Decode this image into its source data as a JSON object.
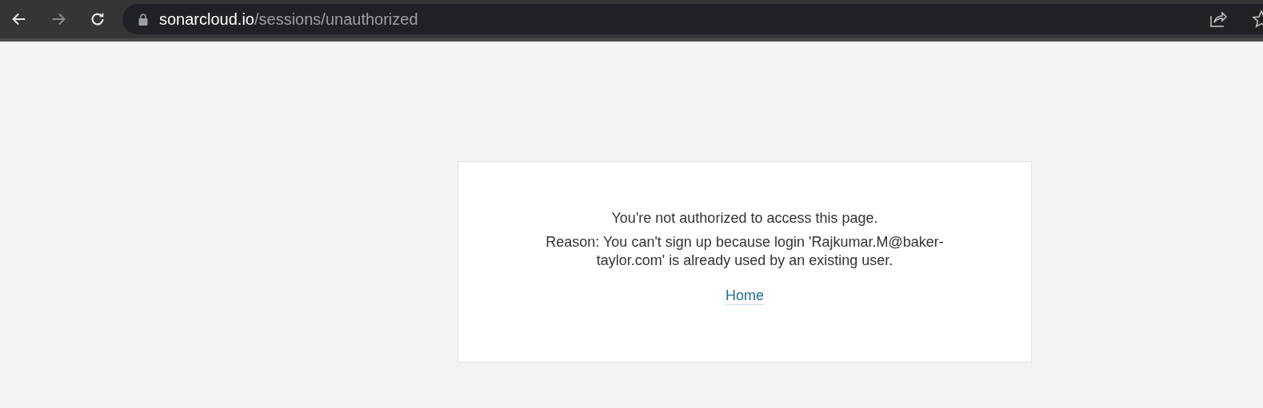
{
  "browser": {
    "url_host": "sonarcloud.io",
    "url_path": "/sessions/unauthorized",
    "forward_disabled": true
  },
  "message": {
    "title": "You're not authorized to access this page.",
    "reason": "Reason: You can't sign up because login 'Rajkumar.M@baker-taylor.com' is already used by an existing user.",
    "link": "Home"
  }
}
